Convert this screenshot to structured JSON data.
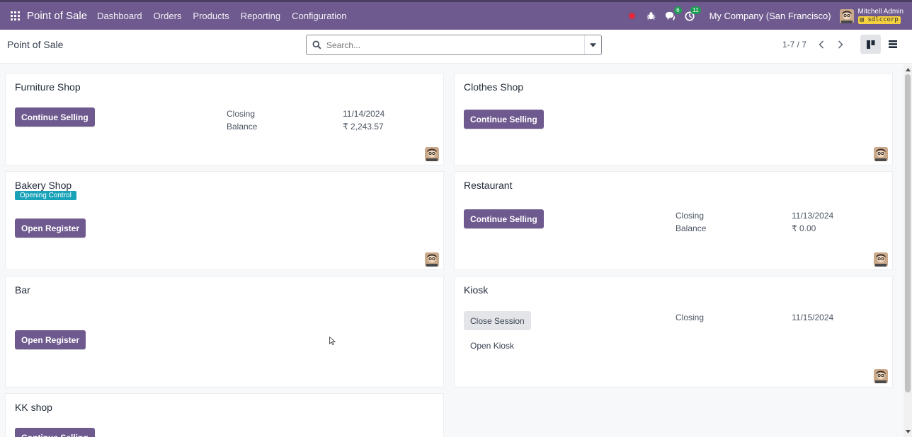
{
  "navbar": {
    "app_title": "Point of Sale",
    "menu": [
      "Dashboard",
      "Orders",
      "Products",
      "Reporting",
      "Configuration"
    ],
    "messages_count": "6",
    "activities_count": "11",
    "company": "My Company (San Francisco)",
    "user_name": "Mitchell Admin",
    "database": "sdlccorp",
    "accent_color": "#6e5a8e"
  },
  "control_panel": {
    "breadcrumb": "Point of Sale",
    "search_placeholder": "Search...",
    "pager": "1-7 / 7"
  },
  "cards": {
    "furniture": {
      "title": "Furniture Shop",
      "button": "Continue Selling",
      "closing_label": "Closing",
      "closing_value": "11/14/2024",
      "balance_label": "Balance",
      "balance_value": "₹ 2,243.57"
    },
    "clothes": {
      "title": "Clothes Shop",
      "button": "Continue Selling"
    },
    "bakery": {
      "title": "Bakery Shop",
      "badge": "Opening Control",
      "button": "Open Register"
    },
    "restaurant": {
      "title": "Restaurant",
      "button": "Continue Selling",
      "closing_label": "Closing",
      "closing_value": "11/13/2024",
      "balance_label": "Balance",
      "balance_value": "₹ 0.00"
    },
    "bar": {
      "title": "Bar",
      "button": "Open Register"
    },
    "kiosk": {
      "title": "Kiosk",
      "button": "Close Session",
      "link": "Open Kiosk",
      "closing_label": "Closing",
      "closing_value": "11/15/2024"
    },
    "kk": {
      "title": "KK shop",
      "button": "Continue Selling"
    }
  }
}
